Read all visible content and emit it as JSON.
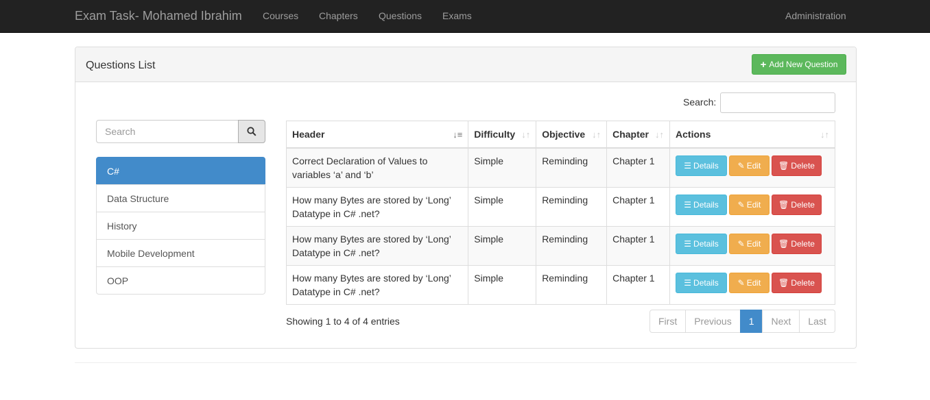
{
  "navbar": {
    "brand": "Exam Task- Mohamed Ibrahim",
    "links": [
      "Courses",
      "Chapters",
      "Questions",
      "Exams"
    ],
    "right": "Administration"
  },
  "panel": {
    "title": "Questions List",
    "add_button": "Add New Question"
  },
  "sidebar": {
    "search_placeholder": "Search",
    "items": [
      "C#",
      "Data Structure",
      "History",
      "Mobile Development",
      "OOP"
    ],
    "active_index": 0
  },
  "table": {
    "search_label": "Search:",
    "columns": [
      "Header",
      "Difficulty",
      "Objective",
      "Chapter",
      "Actions"
    ],
    "rows": [
      {
        "header": "Correct Declaration of Values to variables ‘a’ and ‘b’",
        "difficulty": "Simple",
        "objective": "Reminding",
        "chapter": "Chapter 1"
      },
      {
        "header": "How many Bytes are stored by ‘Long’ Datatype in C# .net?",
        "difficulty": "Simple",
        "objective": "Reminding",
        "chapter": "Chapter 1"
      },
      {
        "header": "How many Bytes are stored by ‘Long’ Datatype in C# .net?",
        "difficulty": "Simple",
        "objective": "Reminding",
        "chapter": "Chapter 1"
      },
      {
        "header": "How many Bytes are stored by ‘Long’ Datatype in C# .net?",
        "difficulty": "Simple",
        "objective": "Reminding",
        "chapter": "Chapter 1"
      }
    ],
    "actions": {
      "details": "Details",
      "edit": "Edit",
      "delete": "Delete"
    }
  },
  "footer": {
    "info": "Showing 1 to 4 of 4 entries",
    "pagination": [
      "First",
      "Previous",
      "1",
      "Next",
      "Last"
    ],
    "active_page": "1"
  },
  "colors": {
    "navbar": "#222222",
    "primary": "#428bca",
    "success": "#5cb85c",
    "info": "#5bc0de",
    "warning": "#f0ad4e",
    "danger": "#d9534f"
  }
}
